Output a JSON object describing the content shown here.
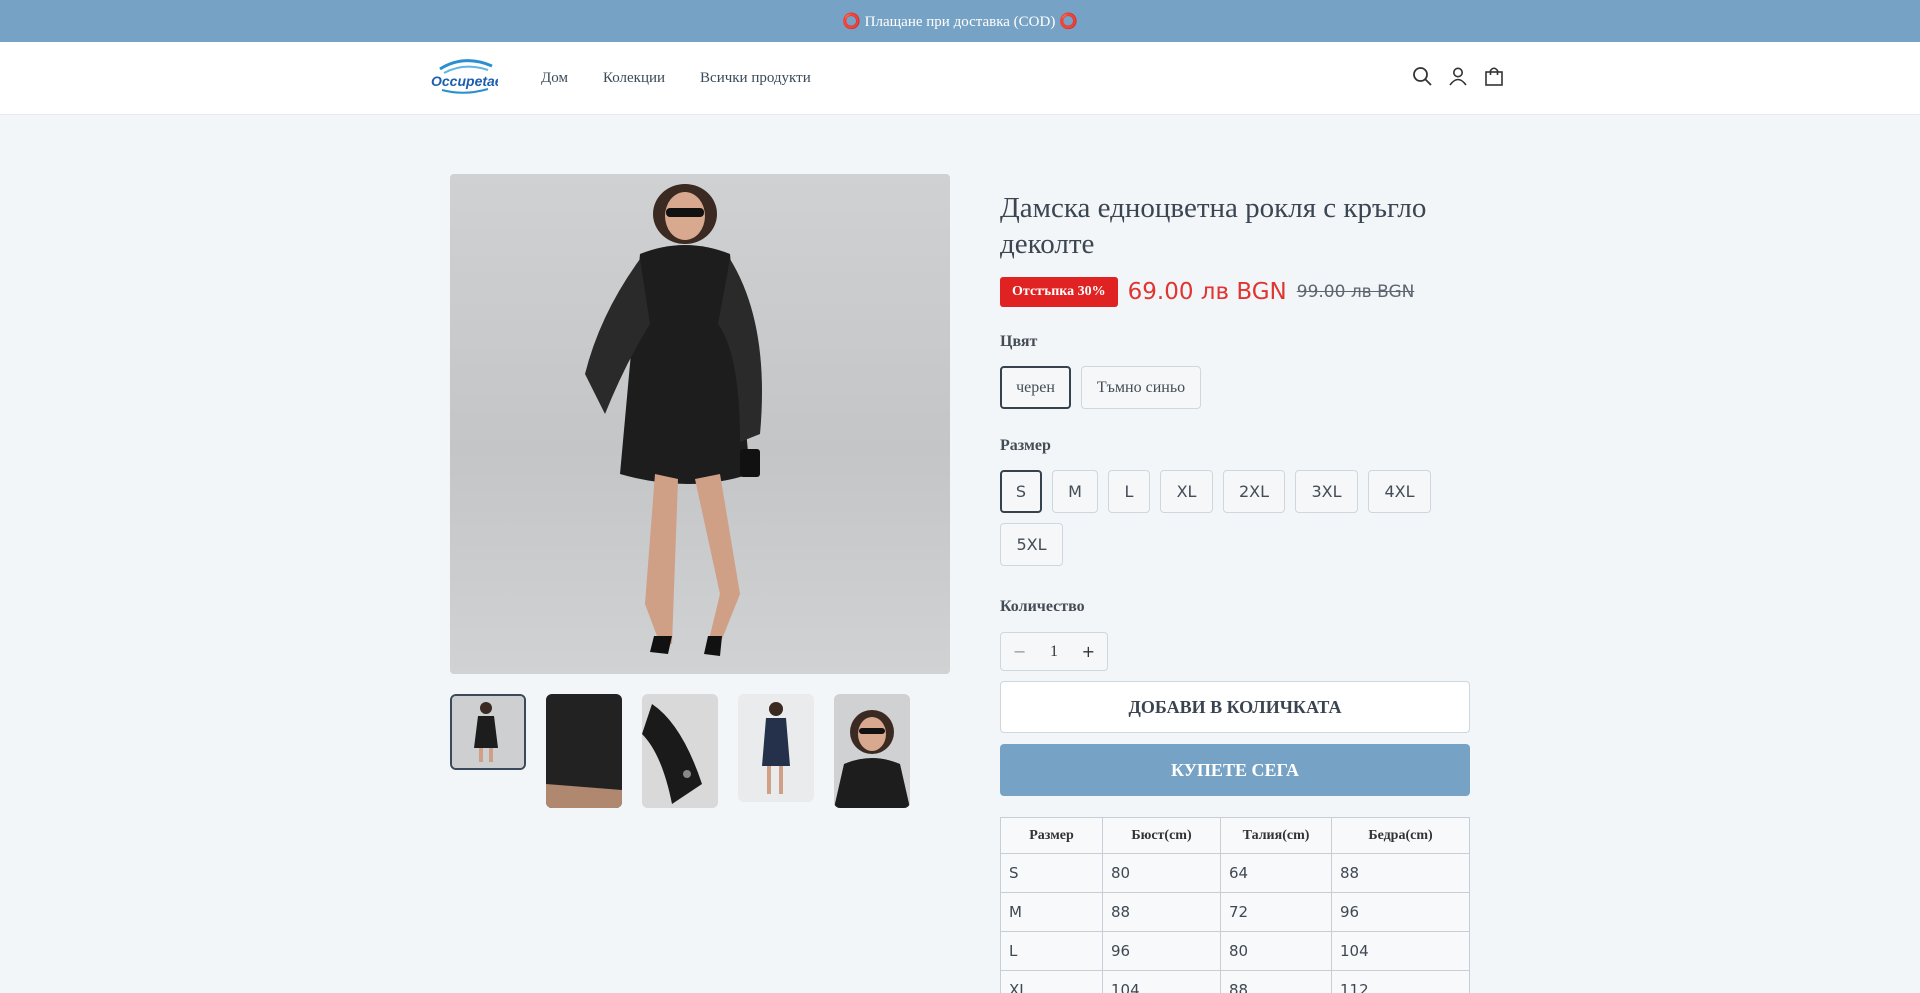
{
  "announcement": "⭕ Плащане при доставка (COD) ⭕",
  "logo": {
    "text": "Occupetae",
    "color": "#1b5fb0"
  },
  "nav": [
    "Дом",
    "Колекции",
    "Всички продукти"
  ],
  "header_icons": [
    "search-icon",
    "account-icon",
    "cart-icon"
  ],
  "product": {
    "title": "Дамска едноцветна рокля с кръгло деколте",
    "badge": "Отстъпка 30%",
    "price": "69.00 лв BGN",
    "old_price": "99.00 лв BGN",
    "color_label": "Цвят",
    "colors": [
      "черен",
      "Тъмно синьо"
    ],
    "selected_color": "черен",
    "size_label": "Размер",
    "sizes": [
      "S",
      "M",
      "L",
      "XL",
      "2XL",
      "3XL",
      "4XL",
      "5XL"
    ],
    "selected_size": "S",
    "quantity_label": "Количество",
    "quantity": "1",
    "add_to_cart": "ДОБАВИ В КОЛИЧКАТА",
    "buy_now": "КУПЕТЕ СЕГА",
    "accent_color": "#76a3c5",
    "sale_color": "#e02222"
  },
  "size_table": {
    "headers": [
      "Размер",
      "Бюст(cm)",
      "Талия(cm)",
      "Бедра(cm)"
    ],
    "rows": [
      [
        "S",
        "80",
        "64",
        "88"
      ],
      [
        "M",
        "88",
        "72",
        "96"
      ],
      [
        "L",
        "96",
        "80",
        "104"
      ],
      [
        "XL",
        "104",
        "88",
        "112"
      ]
    ]
  }
}
